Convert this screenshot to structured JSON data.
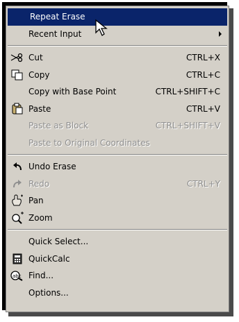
{
  "menu": {
    "items": [
      {
        "label": "Repeat Erase",
        "shortcut": "",
        "icon": "none",
        "state": "highlight"
      },
      {
        "label": "Recent Input",
        "shortcut": "",
        "icon": "none",
        "state": "normal",
        "submenu": true
      },
      {
        "separator": true
      },
      {
        "label": "Cut",
        "shortcut": "CTRL+X",
        "icon": "scissors-icon",
        "state": "normal"
      },
      {
        "label": "Copy",
        "shortcut": "CTRL+C",
        "icon": "copy-icon",
        "state": "normal"
      },
      {
        "label": "Copy with Base Point",
        "shortcut": "CTRL+SHIFT+C",
        "icon": "none",
        "state": "normal"
      },
      {
        "label": "Paste",
        "shortcut": "CTRL+V",
        "icon": "paste-icon",
        "state": "normal"
      },
      {
        "label": "Paste as Block",
        "shortcut": "CTRL+SHIFT+V",
        "icon": "none",
        "state": "disabled"
      },
      {
        "label": "Paste to Original Coordinates",
        "shortcut": "",
        "icon": "none",
        "state": "disabled"
      },
      {
        "separator": true
      },
      {
        "label": "Undo Erase",
        "shortcut": "",
        "icon": "undo-icon",
        "state": "normal"
      },
      {
        "label": "Redo",
        "shortcut": "CTRL+Y",
        "icon": "redo-icon",
        "state": "disabled"
      },
      {
        "label": "Pan",
        "shortcut": "",
        "icon": "pan-icon",
        "state": "normal"
      },
      {
        "label": "Zoom",
        "shortcut": "",
        "icon": "zoom-icon",
        "state": "normal"
      },
      {
        "separator": true
      },
      {
        "label": "Quick Select...",
        "shortcut": "",
        "icon": "none",
        "state": "normal"
      },
      {
        "label": "QuickCalc",
        "shortcut": "",
        "icon": "calculator-icon",
        "state": "normal"
      },
      {
        "label": "Find...",
        "shortcut": "",
        "icon": "find-icon",
        "state": "normal"
      },
      {
        "label": "Options...",
        "shortcut": "",
        "icon": "none",
        "state": "normal"
      }
    ]
  },
  "colors": {
    "menu_bg": "#d4d0c8",
    "highlight_bg": "#0a246a",
    "highlight_text": "#ffffff",
    "disabled_text": "#8f8f8f"
  }
}
